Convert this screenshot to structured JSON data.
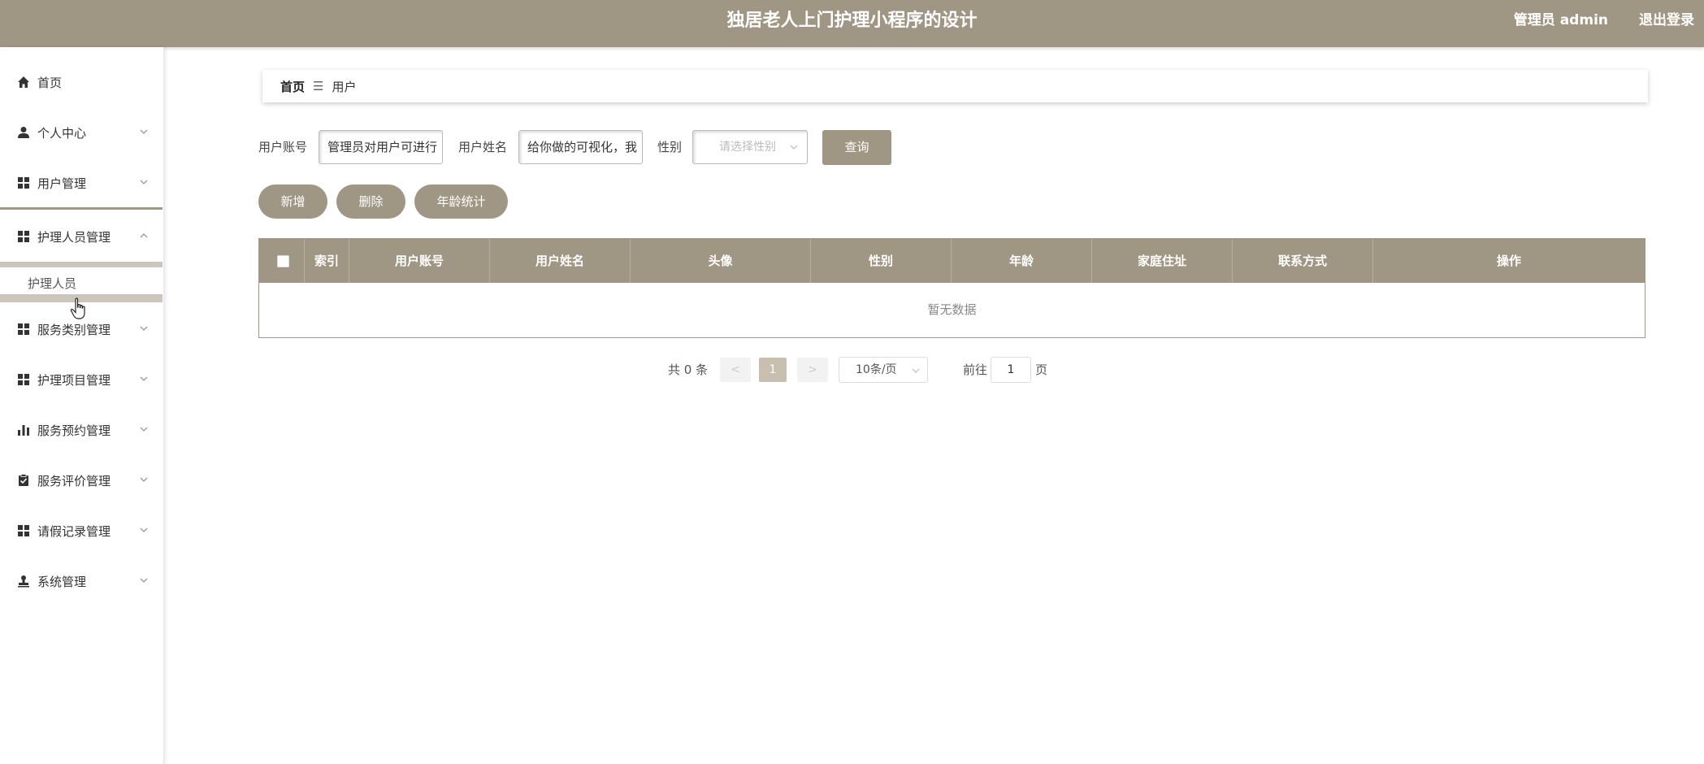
{
  "header": {
    "title": "独居老人上门护理小程序的设计",
    "user": "管理员 admin",
    "logout": "退出登录"
  },
  "sidebar": {
    "items": [
      {
        "label": "首页",
        "icon": "home-icon"
      },
      {
        "label": "个人中心",
        "icon": "person-icon"
      },
      {
        "label": "用户管理",
        "icon": "grid-icon"
      },
      {
        "label": "护理人员管理",
        "icon": "grid-icon",
        "expanded": true,
        "children": [
          {
            "label": "护理人员"
          }
        ]
      },
      {
        "label": "服务类别管理",
        "icon": "grid-icon"
      },
      {
        "label": "护理项目管理",
        "icon": "grid-icon"
      },
      {
        "label": "服务预约管理",
        "icon": "bar-chart-icon"
      },
      {
        "label": "服务评价管理",
        "icon": "clipboard-check-icon"
      },
      {
        "label": "请假记录管理",
        "icon": "grid-icon"
      },
      {
        "label": "系统管理",
        "icon": "stamp-icon"
      }
    ]
  },
  "breadcrumb": {
    "home": "首页",
    "separator": "☰",
    "current": "用户"
  },
  "search": {
    "account_label": "用户账号",
    "account_value": "管理员对用户可进行",
    "name_label": "用户姓名",
    "name_value": "给你做的可视化，我",
    "gender_label": "性别",
    "gender_placeholder": "请选择性别",
    "query_button": "查询"
  },
  "actions": {
    "add": "新增",
    "delete": "删除",
    "age_stats": "年龄统计"
  },
  "table": {
    "columns": [
      "索引",
      "用户账号",
      "用户姓名",
      "头像",
      "性别",
      "年龄",
      "家庭住址",
      "联系方式",
      "操作"
    ],
    "empty_text": "暂无数据"
  },
  "pagination": {
    "total": "共 0 条",
    "prev": "<",
    "current_page": "1",
    "next": ">",
    "page_size": "10条/页",
    "goto_label": "前往",
    "goto_value": "1",
    "page_unit": "页"
  },
  "colors": {
    "accent": "#a09684"
  }
}
